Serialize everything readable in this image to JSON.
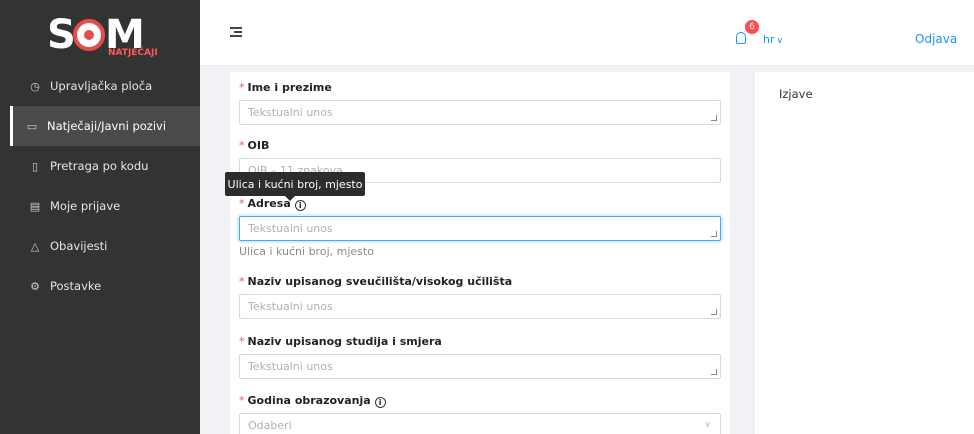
{
  "logo": {
    "main_left": "S",
    "main_right": "M",
    "sub": "NATJEČAJI"
  },
  "sidebar": {
    "items": [
      {
        "label": "Upravljačka ploča",
        "icon": "dashboard-icon"
      },
      {
        "label": "Natječaji/Javni pozivi",
        "icon": "folder-open-icon",
        "active": true
      },
      {
        "label": "Pretraga po kodu",
        "icon": "file-icon"
      },
      {
        "label": "Moje prijave",
        "icon": "file-text-icon"
      },
      {
        "label": "Obavijesti",
        "icon": "bell-icon"
      },
      {
        "label": "Postavke",
        "icon": "gear-icon"
      }
    ]
  },
  "header": {
    "notification_count": "6",
    "language": "hr",
    "logout": "Odjava"
  },
  "form": {
    "fields": [
      {
        "label": "Ime i prezime",
        "placeholder": "Tekstualni unos"
      },
      {
        "label": "OIB",
        "placeholder": "OIB – 11 znakova"
      },
      {
        "label": "Adresa",
        "placeholder": "Tekstualni unos",
        "help": "Ulica i kućni broj, mjesto"
      },
      {
        "label": "Naziv upisanog sveučilišta/visokog učilišta",
        "placeholder": "Tekstualni unos"
      },
      {
        "label": "Naziv upisanog studija i smjera",
        "placeholder": "Tekstualni unos"
      },
      {
        "label": "Godina obrazovanja",
        "placeholder": "Odaberi"
      }
    ],
    "required_mark": "*"
  },
  "tooltip": {
    "text": "Ulica i kućni broj, mjesto"
  },
  "right_panel": {
    "items": [
      {
        "label": "Izjave"
      }
    ]
  },
  "colors": {
    "sidebar_bg": "#333333",
    "accent": "#1e90ff",
    "danger": "#ff4d4f",
    "logo_red": "#e54d4d"
  }
}
